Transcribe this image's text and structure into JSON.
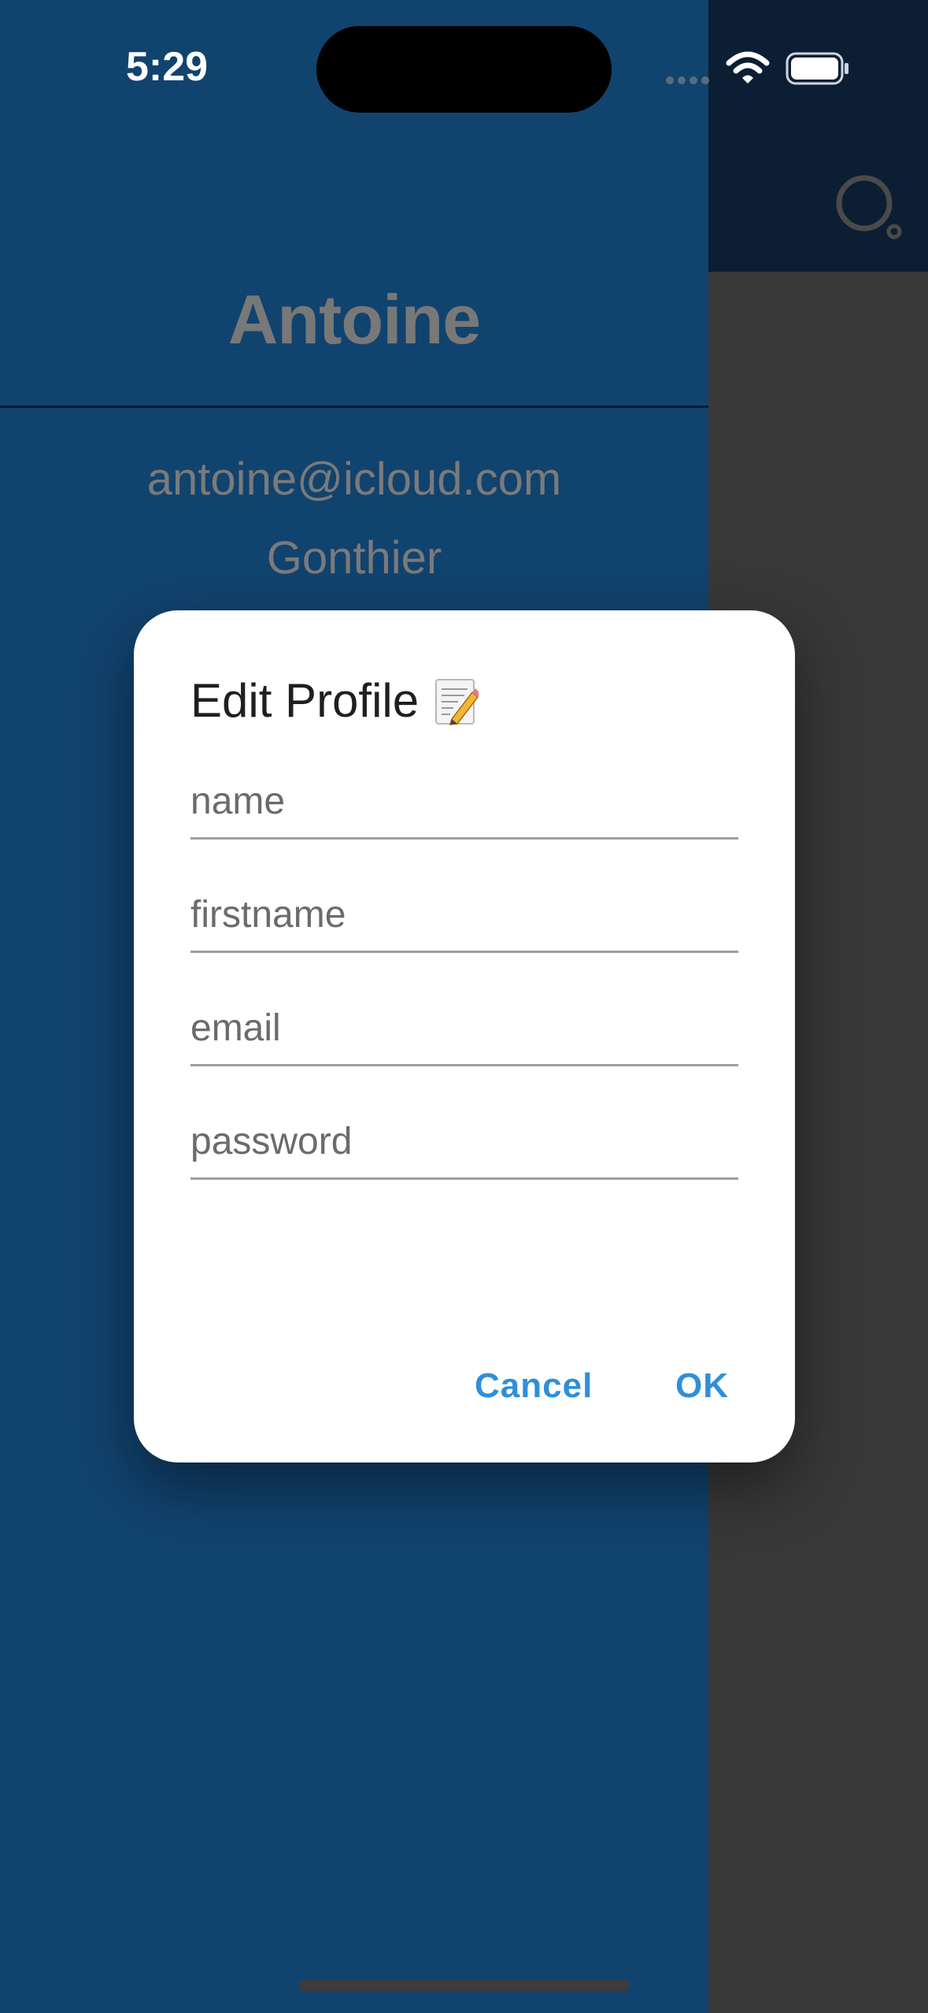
{
  "status_bar": {
    "time": "5:29",
    "icons": [
      "signal-dots-icon",
      "wifi-icon",
      "battery-icon"
    ]
  },
  "app_bar": {
    "actions": [
      "search-icon"
    ]
  },
  "drawer": {
    "header_name": "Antoine",
    "email": "antoine@icloud.com",
    "lastname": "Gonthier"
  },
  "dialog": {
    "title": "Edit Profile",
    "title_icon": "memo-pencil-icon",
    "fields": [
      {
        "placeholder": "name",
        "value": ""
      },
      {
        "placeholder": "firstname",
        "value": ""
      },
      {
        "placeholder": "email",
        "value": ""
      },
      {
        "placeholder": "password",
        "value": ""
      }
    ],
    "cancel_label": "Cancel",
    "ok_label": "OK"
  },
  "colors": {
    "drawer_bg": "#11436f",
    "appbar_bg": "#0b1e33",
    "scrim_bg": "#383838",
    "accent": "#2f8fd9"
  }
}
